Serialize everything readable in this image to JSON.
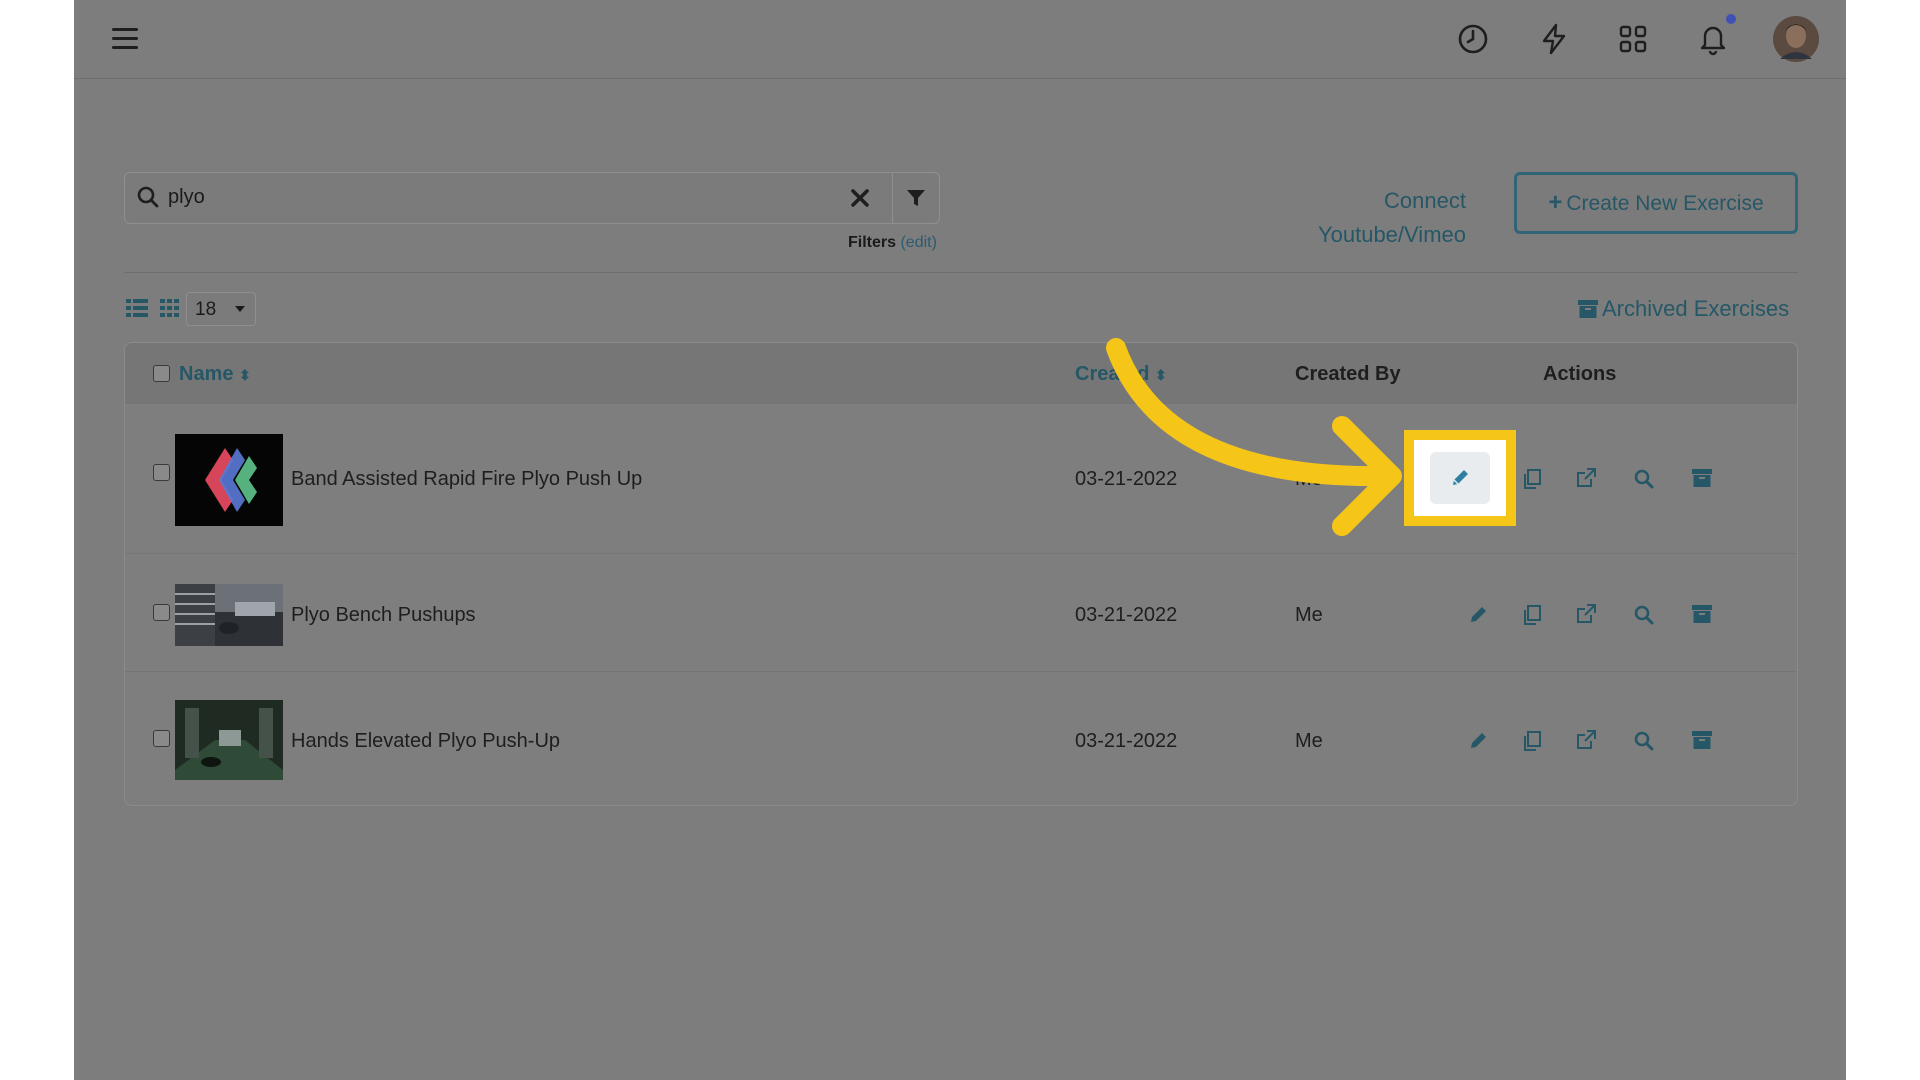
{
  "search": {
    "value": "plyo"
  },
  "filters": {
    "label": "Filters",
    "edit_open": "(",
    "edit_link": "edit",
    "edit_close": ")"
  },
  "connect": {
    "line1": "Connect",
    "line2": "Youtube/Vimeo"
  },
  "create_button": {
    "plus": "+",
    "label": "Create New Exercise"
  },
  "per_page": {
    "value": "18"
  },
  "archived": {
    "label": "Archived Exercises"
  },
  "table": {
    "headers": {
      "name": "Name",
      "created": "Created",
      "created_by": "Created By",
      "actions": "Actions"
    },
    "rows": [
      {
        "name": "Band Assisted Rapid Fire Plyo Push Up",
        "created": "03-21-2022",
        "created_by": "Me"
      },
      {
        "name": "Plyo Bench Pushups",
        "created": "03-21-2022",
        "created_by": "Me"
      },
      {
        "name": "Hands Elevated Plyo Push-Up",
        "created": "03-21-2022",
        "created_by": "Me"
      }
    ]
  },
  "colors": {
    "overlay": "#7d7d7d",
    "accent": "#265766",
    "highlight": "#f5c518",
    "arrow": "#f5c518",
    "notification_dot": "#3f51b5"
  },
  "icons": [
    "hamburger-icon",
    "clock-icon",
    "lightning-icon",
    "apps-grid-icon",
    "bell-icon",
    "avatar",
    "search-icon",
    "clear-icon",
    "filter-icon",
    "list-view-icon",
    "grid-view-icon",
    "archive-icon",
    "edit-icon",
    "copy-icon",
    "external-link-icon",
    "preview-icon",
    "archive-row-icon",
    "annotation-arrow"
  ]
}
